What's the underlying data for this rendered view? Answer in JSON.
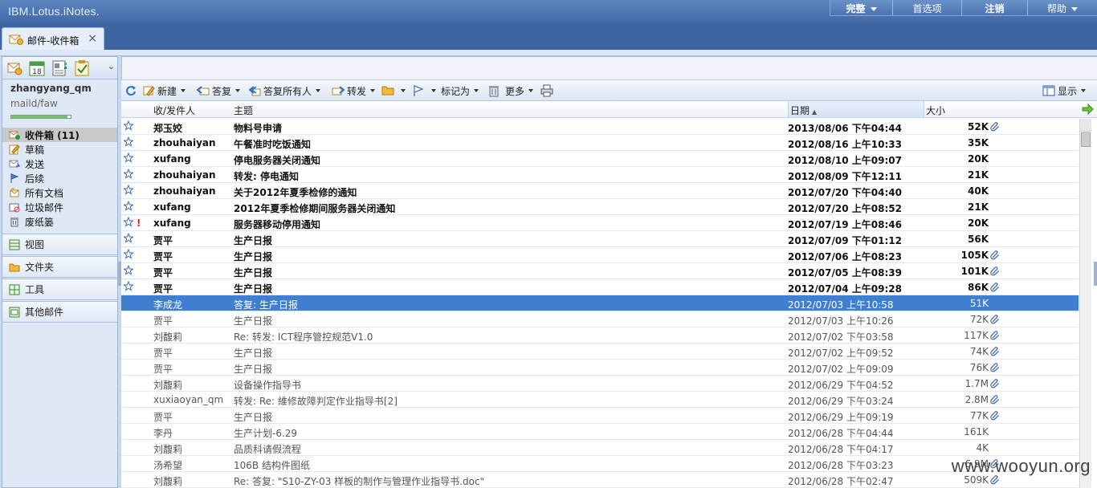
{
  "app": {
    "title": "IBM.Lotus.iNotes."
  },
  "topnav": [
    {
      "label": "完整",
      "bold": true,
      "dropdown": true
    },
    {
      "label": "首选项",
      "bold": false,
      "dropdown": false
    },
    {
      "label": "注销",
      "bold": true,
      "dropdown": false
    },
    {
      "label": "帮助",
      "bold": false,
      "dropdown": true
    }
  ],
  "tab": {
    "label": "邮件-收件箱",
    "close": "×"
  },
  "sidebar": {
    "user": "zhangyang_qm",
    "server": "maild/faw",
    "quota_fraction": 0.95,
    "folders": [
      {
        "label": "收件箱 (11)",
        "icon": "inbox-icon",
        "selected": true
      },
      {
        "label": "草稿",
        "icon": "drafts-icon"
      },
      {
        "label": "发送",
        "icon": "sent-icon"
      },
      {
        "label": "后续",
        "icon": "follow-up-flag-icon"
      },
      {
        "label": "所有文档",
        "icon": "all-documents-icon"
      },
      {
        "label": "垃圾邮件",
        "icon": "junk-icon"
      },
      {
        "label": "废纸篓",
        "icon": "trash-icon"
      }
    ],
    "sections": [
      {
        "label": "视图",
        "icon": "views-icon"
      },
      {
        "label": "文件夹",
        "icon": "folder-icon"
      },
      {
        "label": "工具",
        "icon": "tools-icon"
      },
      {
        "label": "其他邮件",
        "icon": "other-mail-icon"
      }
    ]
  },
  "toolbar": {
    "new": "新建",
    "reply": "答复",
    "reply_all": "答复所有人",
    "forward": "转发",
    "mark_as": "标记为",
    "more": "更多",
    "display": "显示"
  },
  "columns": {
    "from": "收/发件人",
    "subject": "主题",
    "date": "日期",
    "size": "大小"
  },
  "messages": [
    {
      "from": "郑玉姣",
      "subject": "物料号申请",
      "date": "2013/08/06 下午04:44",
      "size": "52K",
      "attachment": true,
      "unread": true,
      "important": false,
      "selected": false
    },
    {
      "from": "zhouhaiyan",
      "subject": "午餐准时吃饭通知",
      "date": "2012/08/16 上午10:33",
      "size": "35K",
      "attachment": false,
      "unread": true,
      "important": false,
      "selected": false
    },
    {
      "from": "xufang",
      "subject": "停电服务器关闭通知",
      "date": "2012/08/10 上午09:07",
      "size": "20K",
      "attachment": false,
      "unread": true,
      "important": false,
      "selected": false
    },
    {
      "from": "zhouhaiyan",
      "subject": "转发: 停电通知",
      "date": "2012/08/09 下午12:11",
      "size": "21K",
      "attachment": false,
      "unread": true,
      "important": false,
      "selected": false
    },
    {
      "from": "zhouhaiyan",
      "subject": "关于2012年夏季检修的通知",
      "date": "2012/07/20 下午04:40",
      "size": "40K",
      "attachment": false,
      "unread": true,
      "important": false,
      "selected": false
    },
    {
      "from": "xufang",
      "subject": "2012年夏季检修期间服务器关闭通知",
      "date": "2012/07/20 上午08:52",
      "size": "21K",
      "attachment": false,
      "unread": true,
      "important": false,
      "selected": false
    },
    {
      "from": "xufang",
      "subject": "服务器移动停用通知",
      "date": "2012/07/19 上午08:46",
      "size": "20K",
      "attachment": false,
      "unread": true,
      "important": true,
      "selected": false
    },
    {
      "from": "贾平",
      "subject": "生产日报",
      "date": "2012/07/09 下午01:12",
      "size": "56K",
      "attachment": false,
      "unread": true,
      "important": false,
      "selected": false
    },
    {
      "from": "贾平",
      "subject": " 生产日报",
      "date": "2012/07/06 上午08:23",
      "size": "105K",
      "attachment": true,
      "unread": true,
      "important": false,
      "selected": false
    },
    {
      "from": "贾平",
      "subject": "生产日报",
      "date": "2012/07/05 上午08:39",
      "size": "101K",
      "attachment": true,
      "unread": true,
      "important": false,
      "selected": false
    },
    {
      "from": "贾平",
      "subject": "生产日报",
      "date": "2012/07/04 上午09:28",
      "size": "86K",
      "attachment": true,
      "unread": true,
      "important": false,
      "selected": false
    },
    {
      "from": "李成龙",
      "subject": "答复: 生产日报",
      "date": "2012/07/03 上午10:58",
      "size": "51K",
      "attachment": false,
      "unread": false,
      "important": false,
      "selected": true
    },
    {
      "from": "贾平",
      "subject": "生产日报",
      "date": "2012/07/03 上午10:26",
      "size": "72K",
      "attachment": true,
      "unread": false,
      "important": false,
      "selected": false
    },
    {
      "from": "刘馥莉",
      "subject": "Re: 转发: ICT程序管控规范V1.0",
      "date": "2012/07/02 下午03:58",
      "size": "117K",
      "attachment": true,
      "unread": false,
      "important": false,
      "selected": false
    },
    {
      "from": "贾平",
      "subject": " 生产日报",
      "date": "2012/07/02 上午09:52",
      "size": "74K",
      "attachment": true,
      "unread": false,
      "important": false,
      "selected": false
    },
    {
      "from": "贾平",
      "subject": "生产日报",
      "date": "2012/07/02 上午09:09",
      "size": "76K",
      "attachment": true,
      "unread": false,
      "important": false,
      "selected": false
    },
    {
      "from": "刘馥莉",
      "subject": "设备操作指导书",
      "date": "2012/06/29 下午04:52",
      "size": "1.7M",
      "attachment": true,
      "unread": false,
      "important": false,
      "selected": false
    },
    {
      "from": "xuxiaoyan_qm",
      "subject": "转发:  Re: 維修故障判定作业指导书[2]",
      "date": "2012/06/29 下午03:24",
      "size": "2.8M",
      "attachment": true,
      "unread": false,
      "important": false,
      "selected": false
    },
    {
      "from": "贾平",
      "subject": "生产日报",
      "date": "2012/06/29 上午09:19",
      "size": "77K",
      "attachment": true,
      "unread": false,
      "important": false,
      "selected": false
    },
    {
      "from": "李丹",
      "subject": "生产计划-6.29",
      "date": "2012/06/28 下午04:44",
      "size": "161K",
      "attachment": false,
      "unread": false,
      "important": false,
      "selected": false
    },
    {
      "from": "刘馥莉",
      "subject": "品质科请假流程",
      "date": "2012/06/28 下午04:17",
      "size": "4K",
      "attachment": false,
      "unread": false,
      "important": false,
      "selected": false
    },
    {
      "from": "汤希望",
      "subject": "106B 结构件图纸",
      "date": "2012/06/28 下午03:23",
      "size": "6.9M",
      "attachment": true,
      "unread": false,
      "important": false,
      "selected": false
    },
    {
      "from": "刘馥莉",
      "subject": "Re: 答复: \"S10-ZY-03 样板的制作与管理作业指导书.doc\"",
      "date": "2012/06/28 下午02:47",
      "size": "509K",
      "attachment": true,
      "unread": false,
      "important": false,
      "selected": false
    }
  ],
  "watermark": "www.wooyun.org",
  "colors": {
    "header": "#4a73b0",
    "selected_row": "#3f7fd1",
    "important": "#dd2222"
  }
}
